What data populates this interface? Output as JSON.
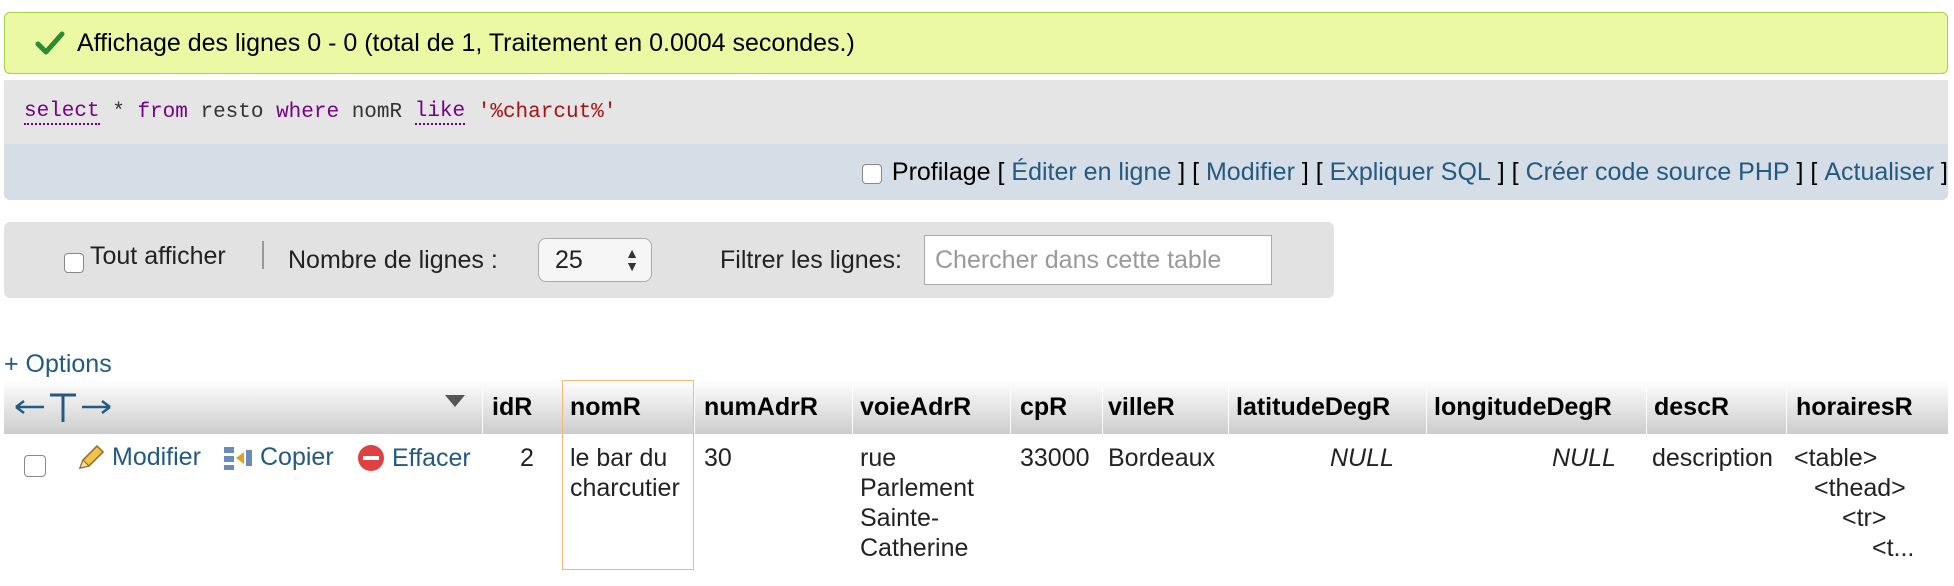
{
  "success": {
    "message": "Affichage des lignes 0 - 0 (total de 1, Traitement en 0.0004 secondes.)"
  },
  "sql": {
    "kw_select": "select",
    "star": " * ",
    "kw_from": "from",
    "table": " resto ",
    "kw_where": "where",
    "column": " nomR ",
    "kw_like": "like",
    "space": " ",
    "literal": "'%charcut%'"
  },
  "tools": {
    "profiling_label": "Profilage",
    "links": [
      "Éditer en ligne",
      "Modifier",
      "Expliquer SQL",
      "Créer code source PHP",
      "Actualiser"
    ]
  },
  "nav": {
    "show_all_label": "Tout afficher",
    "rows_label": "Nombre de lignes :",
    "rows_value": "25",
    "filter_label": "Filtrer les lignes:",
    "filter_placeholder": "Chercher dans cette table"
  },
  "options_link": "+ Options",
  "table": {
    "columns": [
      "idR",
      "nomR",
      "numAdrR",
      "voieAdrR",
      "cpR",
      "villeR",
      "latitudeDegR",
      "longitudeDegR",
      "descR",
      "horairesR"
    ],
    "row_actions": [
      "Modifier",
      "Copier",
      "Effacer"
    ],
    "rows": [
      {
        "idR": "2",
        "nomR": [
          "le bar du",
          "charcutier"
        ],
        "numAdrR": "30",
        "voieAdrR": [
          "rue",
          "Parlement",
          "Sainte-",
          "Catherine"
        ],
        "cpR": "33000",
        "villeR": "Bordeaux",
        "latitudeDegR": "NULL",
        "longitudeDegR": "NULL",
        "descR": "description",
        "horairesR": [
          "<table>",
          "<thead>",
          "<tr>",
          "<t..."
        ]
      }
    ]
  },
  "colors": {
    "success_bg": "#ebf8a4",
    "link": "#235a81",
    "sql_keyword": "#770088",
    "sql_string": "#aa1111"
  }
}
